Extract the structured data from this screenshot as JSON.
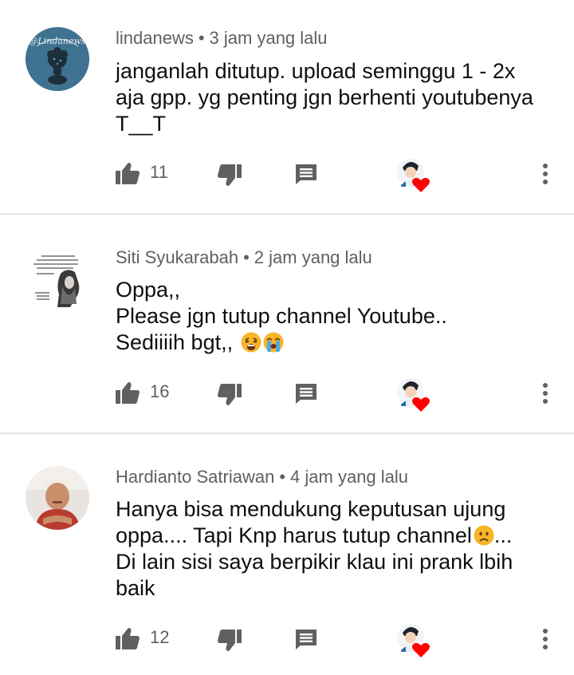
{
  "comments": [
    {
      "author": "lindanews",
      "separator": "•",
      "time": "3 jam yang lalu",
      "lines": [
        "janganlah ditutup. upload seminggu 1 - 2x",
        "aja gpp. yg penting jgn berhenti youtubenya",
        "T__T"
      ],
      "likes": "11",
      "avatar_text": "@Lindanews",
      "avatar_icon": "cartoon-head-avatar-icon"
    },
    {
      "author": "Siti Syukarabah",
      "separator": "•",
      "time": "2 jam yang lalu",
      "lines": [
        "Oppa,,",
        "Please jgn tutup channel Youtube..",
        "Sediiiih bgt,,"
      ],
      "emojis": [
        "weary-face-emoji",
        "loudly-crying-face-emoji"
      ],
      "likes": "16",
      "avatar_icon": "portrait-quote-avatar-icon"
    },
    {
      "author": "Hardianto Satriawan",
      "separator": "•",
      "time": "4 jam yang lalu",
      "lines": [
        "Hanya bisa mendukung keputusan ujung",
        "oppa.... Tapi Knp harus tutup channel",
        "Di lain sisi saya berpikir klau ini prank lbih",
        "baik"
      ],
      "line2_suffix": "...",
      "emojis": [
        "worried-face-emoji"
      ],
      "likes": "12",
      "avatar_icon": "person-photo-avatar-icon"
    }
  ],
  "icons": {
    "like": "thumbs-up-icon",
    "dislike": "thumbs-down-icon",
    "reply": "reply-comment-icon",
    "heart": "creator-heart-icon",
    "more": "more-vertical-icon"
  },
  "colors": {
    "meta": "#606060",
    "icon": "#606060",
    "heart": "#ff0000",
    "divider": "#e5e5e5"
  }
}
